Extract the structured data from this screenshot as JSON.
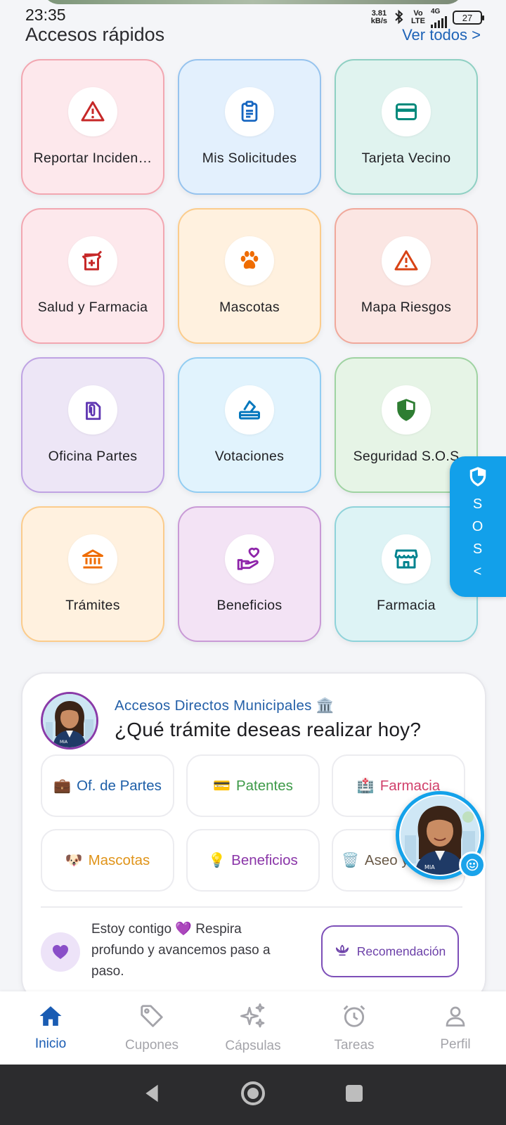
{
  "status_bar": {
    "time": "23:35",
    "speed_value": "3.81",
    "speed_unit": "kB/s",
    "volte_top": "Vo",
    "volte_bottom": "LTE",
    "network": "4G",
    "battery": "27"
  },
  "quick_access": {
    "title": "Accesos rápidos",
    "see_all": "Ver todos >",
    "tiles": [
      {
        "label": "Reportar Inciden…",
        "icon": "warning-icon",
        "bg": "#fde8ec",
        "border": "#f2a7b1",
        "icon_color": "#c62828"
      },
      {
        "label": "Mis Solicitudes",
        "icon": "clipboard-icon",
        "bg": "#e3f0fd",
        "border": "#96c3ee",
        "icon_color": "#1565c0"
      },
      {
        "label": "Tarjeta Vecino",
        "icon": "card-icon",
        "bg": "#e0f3ef",
        "border": "#8fd0c3",
        "icon_color": "#00897b"
      },
      {
        "label": "Salud y Farmacia",
        "icon": "medical-icon",
        "bg": "#fde8ec",
        "border": "#f2a7b1",
        "icon_color": "#c62828"
      },
      {
        "label": "Mascotas",
        "icon": "paw-icon",
        "bg": "#fff1df",
        "border": "#fbcc8c",
        "icon_color": "#ef6c00"
      },
      {
        "label": "Mapa Riesgos",
        "icon": "warning-icon",
        "bg": "#fbe6e3",
        "border": "#f0a89b",
        "icon_color": "#d84315"
      },
      {
        "label": "Oficina Partes",
        "icon": "paperclip-icon",
        "bg": "#ede6f6",
        "border": "#bfa3e3",
        "icon_color": "#5e35b1"
      },
      {
        "label": "Votaciones",
        "icon": "ballot-icon",
        "bg": "#e1f3fd",
        "border": "#92cdf2",
        "icon_color": "#0277bd"
      },
      {
        "label": "Seguridad S.O.S",
        "icon": "shield-icon",
        "bg": "#e6f4e6",
        "border": "#9fd3a2",
        "icon_color": "#2e7d32"
      },
      {
        "label": "Trámites",
        "icon": "bank-icon",
        "bg": "#fff1df",
        "border": "#fbcc8c",
        "icon_color": "#ef6c00"
      },
      {
        "label": "Beneficios",
        "icon": "hand-heart-icon",
        "bg": "#f3e3f5",
        "border": "#c99ad6",
        "icon_color": "#8e24aa"
      },
      {
        "label": "Farmacia",
        "icon": "store-icon",
        "bg": "#ddf3f5",
        "border": "#8fd3da",
        "icon_color": "#00838f"
      }
    ]
  },
  "sos": {
    "letters": [
      "S",
      "O",
      "S"
    ],
    "arrow": "<"
  },
  "assistant_card": {
    "subtitle": "Accesos Directos Municipales 🏛️",
    "title": "¿Qué trámite deseas realizar hoy?",
    "chips": [
      {
        "emoji": "💼",
        "label": "Of. de Partes",
        "color": "#1e5fa8"
      },
      {
        "emoji": "💳",
        "label": "Patentes",
        "color": "#3d9a48"
      },
      {
        "emoji": "🏥",
        "label": "Farmacia",
        "color": "#d1406b"
      },
      {
        "emoji": "🐶",
        "label": "Mascotas",
        "color": "#e0941a"
      },
      {
        "emoji": "💡",
        "label": "Beneficios",
        "color": "#8a35a8"
      },
      {
        "emoji": "🗑️",
        "label": "Aseo y",
        "color": "#6a5a48"
      }
    ],
    "message": "Estoy contigo 💜 Respira profundo y avancemos paso a paso.",
    "recommend_button": "Recomendación"
  },
  "bottom_nav": [
    {
      "label": "Inicio",
      "icon": "home-icon",
      "active": true
    },
    {
      "label": "Cupones",
      "icon": "tag-icon",
      "active": false
    },
    {
      "label": "Cápsulas",
      "icon": "sparkles-icon",
      "active": false
    },
    {
      "label": "Tareas",
      "icon": "alarm-icon",
      "active": false
    },
    {
      "label": "Perfil",
      "icon": "person-icon",
      "active": false
    }
  ],
  "avatar_badge": "MIA"
}
